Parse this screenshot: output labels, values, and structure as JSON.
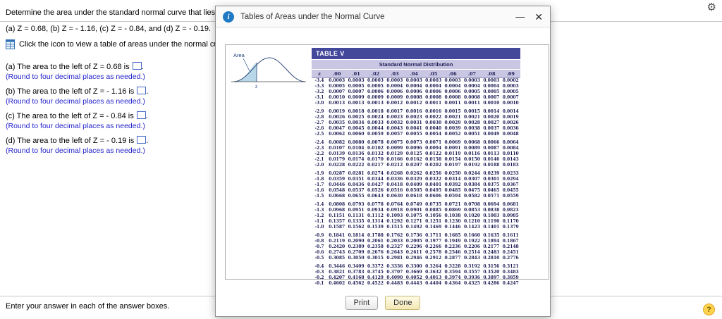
{
  "page": {
    "question_line1": "Determine the area under the standard normal curve that lies to the left of",
    "question_line2": "(a) Z = 0.68, (b) Z = - 1.16, (c) Z = - 0.84, and (d) Z = - 0.19.",
    "table_link": "Click the icon to view a table of areas under the normal curve.",
    "parts": [
      {
        "label": "(a) The area to the left of Z = 0.68 is",
        "suffix": ".",
        "hint": "(Round to four decimal places as needed.)"
      },
      {
        "label": "(b) The area to the left of Z = - 1.16 is",
        "suffix": ".",
        "hint": "(Round to four decimal places as needed.)"
      },
      {
        "label": "(c) The area to the left of Z = - 0.84 is",
        "suffix": ".",
        "hint": "(Round to four decimal places as needed.)"
      },
      {
        "label": "(d) The area to the left of Z = - 0.19 is",
        "suffix": ".",
        "hint": "(Round to four decimal places as needed.)"
      }
    ],
    "footer_instruction": "Enter your answer in each of the answer boxes.",
    "settings_icon": "⚙",
    "help_icon": "?"
  },
  "modal": {
    "title": "Tables of Areas under the Normal Curve",
    "info_icon": "i",
    "minimize_icon": "—",
    "close_icon": "✕",
    "print_label": "Print",
    "done_label": "Done",
    "figure": {
      "area_label": "Area",
      "axis_label": "z"
    },
    "table": {
      "title": "TABLE V",
      "subtitle": "Standard Normal Distribution",
      "columns": [
        "z",
        ".00",
        ".01",
        ".02",
        ".03",
        ".04",
        ".05",
        ".06",
        ".07",
        ".08",
        ".09"
      ],
      "groups": [
        [
          {
            "z": "-3.4",
            "v": [
              "0.0003",
              "0.0003",
              "0.0003",
              "0.0003",
              "0.0003",
              "0.0003",
              "0.0003",
              "0.0003",
              "0.0003",
              "0.0002"
            ]
          },
          {
            "z": "-3.3",
            "v": [
              "0.0005",
              "0.0005",
              "0.0005",
              "0.0004",
              "0.0004",
              "0.0004",
              "0.0004",
              "0.0004",
              "0.0004",
              "0.0003"
            ]
          },
          {
            "z": "-3.2",
            "v": [
              "0.0007",
              "0.0007",
              "0.0006",
              "0.0006",
              "0.0006",
              "0.0006",
              "0.0006",
              "0.0005",
              "0.0005",
              "0.0005"
            ]
          },
          {
            "z": "-3.1",
            "v": [
              "0.0010",
              "0.0009",
              "0.0009",
              "0.0009",
              "0.0008",
              "0.0008",
              "0.0008",
              "0.0008",
              "0.0007",
              "0.0007"
            ]
          },
          {
            "z": "-3.0",
            "v": [
              "0.0013",
              "0.0013",
              "0.0013",
              "0.0012",
              "0.0012",
              "0.0011",
              "0.0011",
              "0.0011",
              "0.0010",
              "0.0010"
            ]
          }
        ],
        [
          {
            "z": "-2.9",
            "v": [
              "0.0019",
              "0.0018",
              "0.0018",
              "0.0017",
              "0.0016",
              "0.0016",
              "0.0015",
              "0.0015",
              "0.0014",
              "0.0014"
            ]
          },
          {
            "z": "-2.8",
            "v": [
              "0.0026",
              "0.0025",
              "0.0024",
              "0.0023",
              "0.0023",
              "0.0022",
              "0.0021",
              "0.0021",
              "0.0020",
              "0.0019"
            ]
          },
          {
            "z": "-2.7",
            "v": [
              "0.0035",
              "0.0034",
              "0.0033",
              "0.0032",
              "0.0031",
              "0.0030",
              "0.0029",
              "0.0028",
              "0.0027",
              "0.0026"
            ]
          },
          {
            "z": "-2.6",
            "v": [
              "0.0047",
              "0.0045",
              "0.0044",
              "0.0043",
              "0.0041",
              "0.0040",
              "0.0039",
              "0.0038",
              "0.0037",
              "0.0036"
            ]
          },
          {
            "z": "-2.5",
            "v": [
              "0.0062",
              "0.0060",
              "0.0059",
              "0.0057",
              "0.0055",
              "0.0054",
              "0.0052",
              "0.0051",
              "0.0049",
              "0.0048"
            ]
          }
        ],
        [
          {
            "z": "-2.4",
            "v": [
              "0.0082",
              "0.0080",
              "0.0078",
              "0.0075",
              "0.0073",
              "0.0071",
              "0.0069",
              "0.0068",
              "0.0066",
              "0.0064"
            ]
          },
          {
            "z": "-2.3",
            "v": [
              "0.0107",
              "0.0104",
              "0.0102",
              "0.0099",
              "0.0096",
              "0.0094",
              "0.0091",
              "0.0089",
              "0.0087",
              "0.0084"
            ]
          },
          {
            "z": "-2.2",
            "v": [
              "0.0139",
              "0.0136",
              "0.0132",
              "0.0129",
              "0.0125",
              "0.0122",
              "0.0119",
              "0.0116",
              "0.0113",
              "0.0110"
            ]
          },
          {
            "z": "-2.1",
            "v": [
              "0.0179",
              "0.0174",
              "0.0170",
              "0.0166",
              "0.0162",
              "0.0158",
              "0.0154",
              "0.0150",
              "0.0146",
              "0.0143"
            ]
          },
          {
            "z": "-2.0",
            "v": [
              "0.0228",
              "0.0222",
              "0.0217",
              "0.0212",
              "0.0207",
              "0.0202",
              "0.0197",
              "0.0192",
              "0.0188",
              "0.0183"
            ]
          }
        ],
        [
          {
            "z": "-1.9",
            "v": [
              "0.0287",
              "0.0281",
              "0.0274",
              "0.0268",
              "0.0262",
              "0.0256",
              "0.0250",
              "0.0244",
              "0.0239",
              "0.0233"
            ]
          },
          {
            "z": "-1.8",
            "v": [
              "0.0359",
              "0.0351",
              "0.0344",
              "0.0336",
              "0.0329",
              "0.0322",
              "0.0314",
              "0.0307",
              "0.0301",
              "0.0294"
            ]
          },
          {
            "z": "-1.7",
            "v": [
              "0.0446",
              "0.0436",
              "0.0427",
              "0.0418",
              "0.0409",
              "0.0401",
              "0.0392",
              "0.0384",
              "0.0375",
              "0.0367"
            ]
          },
          {
            "z": "-1.6",
            "v": [
              "0.0548",
              "0.0537",
              "0.0526",
              "0.0516",
              "0.0505",
              "0.0495",
              "0.0485",
              "0.0475",
              "0.0465",
              "0.0455"
            ]
          },
          {
            "z": "-1.5",
            "v": [
              "0.0668",
              "0.0655",
              "0.0643",
              "0.0630",
              "0.0618",
              "0.0606",
              "0.0594",
              "0.0582",
              "0.0571",
              "0.0559"
            ]
          }
        ],
        [
          {
            "z": "-1.4",
            "v": [
              "0.0808",
              "0.0793",
              "0.0778",
              "0.0764",
              "0.0749",
              "0.0735",
              "0.0721",
              "0.0708",
              "0.0694",
              "0.0681"
            ]
          },
          {
            "z": "-1.3",
            "v": [
              "0.0968",
              "0.0951",
              "0.0934",
              "0.0918",
              "0.0901",
              "0.0885",
              "0.0869",
              "0.0853",
              "0.0838",
              "0.0823"
            ]
          },
          {
            "z": "-1.2",
            "v": [
              "0.1151",
              "0.1131",
              "0.1112",
              "0.1093",
              "0.1075",
              "0.1056",
              "0.1038",
              "0.1020",
              "0.1003",
              "0.0985"
            ]
          },
          {
            "z": "-1.1",
            "v": [
              "0.1357",
              "0.1335",
              "0.1314",
              "0.1292",
              "0.1271",
              "0.1251",
              "0.1230",
              "0.1210",
              "0.1190",
              "0.1170"
            ]
          },
          {
            "z": "-1.0",
            "v": [
              "0.1587",
              "0.1562",
              "0.1539",
              "0.1515",
              "0.1492",
              "0.1469",
              "0.1446",
              "0.1423",
              "0.1401",
              "0.1379"
            ]
          }
        ],
        [
          {
            "z": "-0.9",
            "v": [
              "0.1841",
              "0.1814",
              "0.1788",
              "0.1762",
              "0.1736",
              "0.1711",
              "0.1685",
              "0.1660",
              "0.1635",
              "0.1611"
            ]
          },
          {
            "z": "-0.8",
            "v": [
              "0.2119",
              "0.2090",
              "0.2061",
              "0.2033",
              "0.2005",
              "0.1977",
              "0.1949",
              "0.1922",
              "0.1894",
              "0.1867"
            ]
          },
          {
            "z": "-0.7",
            "v": [
              "0.2420",
              "0.2389",
              "0.2358",
              "0.2327",
              "0.2296",
              "0.2266",
              "0.2236",
              "0.2206",
              "0.2177",
              "0.2148"
            ]
          },
          {
            "z": "-0.6",
            "v": [
              "0.2743",
              "0.2709",
              "0.2676",
              "0.2643",
              "0.2611",
              "0.2578",
              "0.2546",
              "0.2514",
              "0.2483",
              "0.2451"
            ]
          },
          {
            "z": "-0.5",
            "v": [
              "0.3085",
              "0.3050",
              "0.3015",
              "0.2981",
              "0.2946",
              "0.2912",
              "0.2877",
              "0.2843",
              "0.2810",
              "0.2776"
            ]
          }
        ],
        [
          {
            "z": "-0.4",
            "v": [
              "0.3446",
              "0.3409",
              "0.3372",
              "0.3336",
              "0.3300",
              "0.3264",
              "0.3228",
              "0.3192",
              "0.3156",
              "0.3121"
            ]
          },
          {
            "z": "-0.3",
            "v": [
              "0.3821",
              "0.3783",
              "0.3745",
              "0.3707",
              "0.3669",
              "0.3632",
              "0.3594",
              "0.3557",
              "0.3520",
              "0.3483"
            ]
          },
          {
            "z": "-0.2",
            "v": [
              "0.4207",
              "0.4168",
              "0.4129",
              "0.4090",
              "0.4052",
              "0.4013",
              "0.3974",
              "0.3936",
              "0.3897",
              "0.3859"
            ]
          },
          {
            "z": "-0.1",
            "v": [
              "0.4602",
              "0.4562",
              "0.4522",
              "0.4483",
              "0.4443",
              "0.4404",
              "0.4364",
              "0.4325",
              "0.4286",
              "0.4247"
            ]
          }
        ]
      ]
    }
  }
}
